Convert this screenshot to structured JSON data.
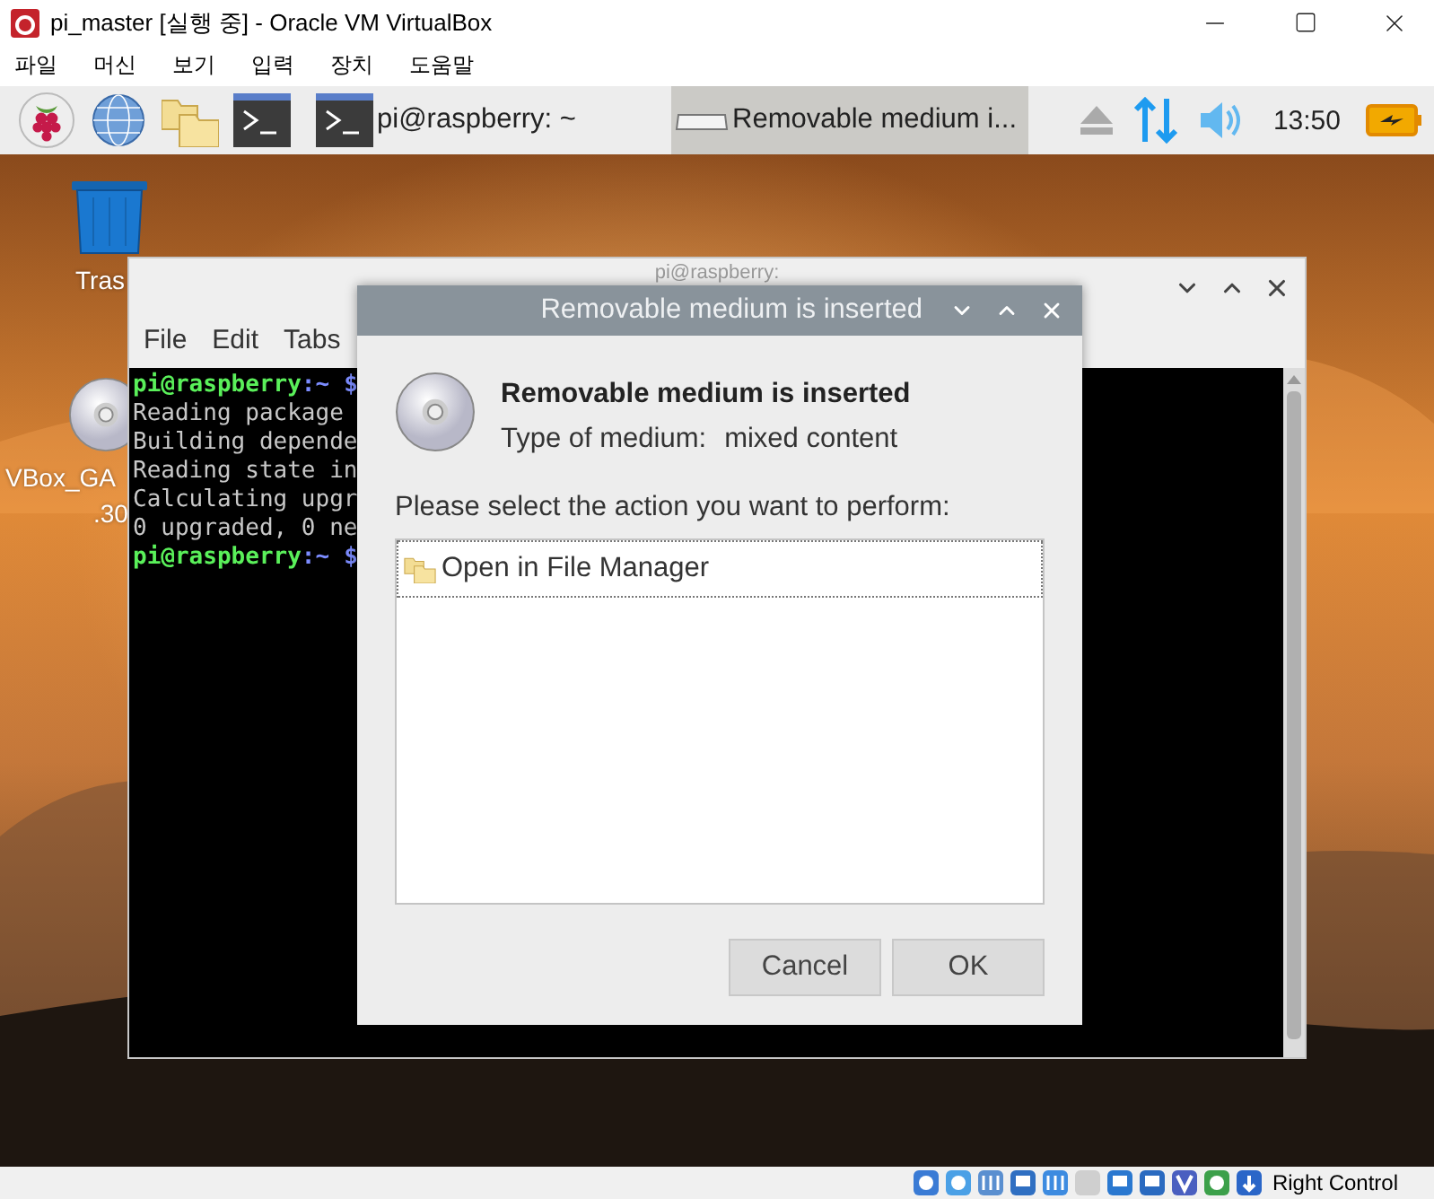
{
  "window": {
    "title": "pi_master [실행 중] - Oracle VM VirtualBox"
  },
  "menu": [
    "파일",
    "머신",
    "보기",
    "입력",
    "장치",
    "도움말"
  ],
  "panel": {
    "tasks": [
      {
        "label": "pi@raspberry: ~",
        "selected": false
      },
      {
        "label": "Removable medium i...",
        "selected": true
      }
    ],
    "clock": "13:50"
  },
  "desktop_icons": [
    {
      "kind": "trash",
      "lines": [
        "Tras"
      ]
    },
    {
      "kind": "disc",
      "lines": [
        "VBox_GA",
        ".30"
      ]
    }
  ],
  "terminal": {
    "title": "pi@raspberry:",
    "menu": [
      "File",
      "Edit",
      "Tabs"
    ],
    "lines": [
      {
        "kind": "prompt",
        "user": "pi@raspberry",
        "path": ":~",
        "sign": "$"
      },
      {
        "kind": "output",
        "text": "Reading package"
      },
      {
        "kind": "output",
        "text": "Building depende"
      },
      {
        "kind": "output",
        "text": "Reading state in"
      },
      {
        "kind": "output",
        "text": "Calculating upgr"
      },
      {
        "kind": "output",
        "text": "0 upgraded, 0 ne"
      },
      {
        "kind": "prompt",
        "user": "pi@raspberry",
        "path": ":~",
        "sign": "$"
      }
    ]
  },
  "dialog": {
    "title": "Removable medium is inserted",
    "heading": "Removable medium is inserted",
    "type_label": "Type of medium:",
    "type_value": "mixed content",
    "prompt": "Please select the action you want to perform:",
    "actions": [
      {
        "label": "Open in File Manager",
        "selected": true
      }
    ],
    "buttons": [
      "Cancel",
      "OK"
    ]
  },
  "status_bar": {
    "host_key": "Right Control"
  }
}
